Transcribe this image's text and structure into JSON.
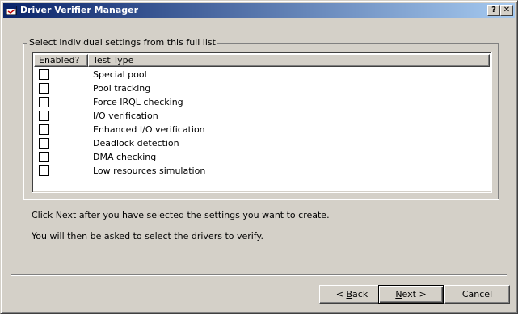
{
  "window": {
    "title": "Driver Verifier Manager",
    "help_button": "?",
    "close_button": "✕"
  },
  "group": {
    "label": "Select individual settings from this full list"
  },
  "list": {
    "columns": [
      "Enabled?",
      "Test Type"
    ],
    "rows": [
      {
        "enabled": false,
        "label": "Special pool"
      },
      {
        "enabled": false,
        "label": "Pool tracking"
      },
      {
        "enabled": false,
        "label": "Force IRQL checking"
      },
      {
        "enabled": false,
        "label": "I/O verification"
      },
      {
        "enabled": false,
        "label": "Enhanced I/O verification"
      },
      {
        "enabled": false,
        "label": "Deadlock detection"
      },
      {
        "enabled": false,
        "label": "DMA checking"
      },
      {
        "enabled": false,
        "label": "Low resources simulation"
      }
    ]
  },
  "info": {
    "line1": "Click Next after you have selected the settings you want to create.",
    "line2": "You will then be asked to select the drivers to verify."
  },
  "buttons": {
    "back_prefix": "< ",
    "back_mnemonic": "B",
    "back_rest": "ack",
    "next_mnemonic": "N",
    "next_rest": "ext >",
    "cancel": "Cancel"
  }
}
